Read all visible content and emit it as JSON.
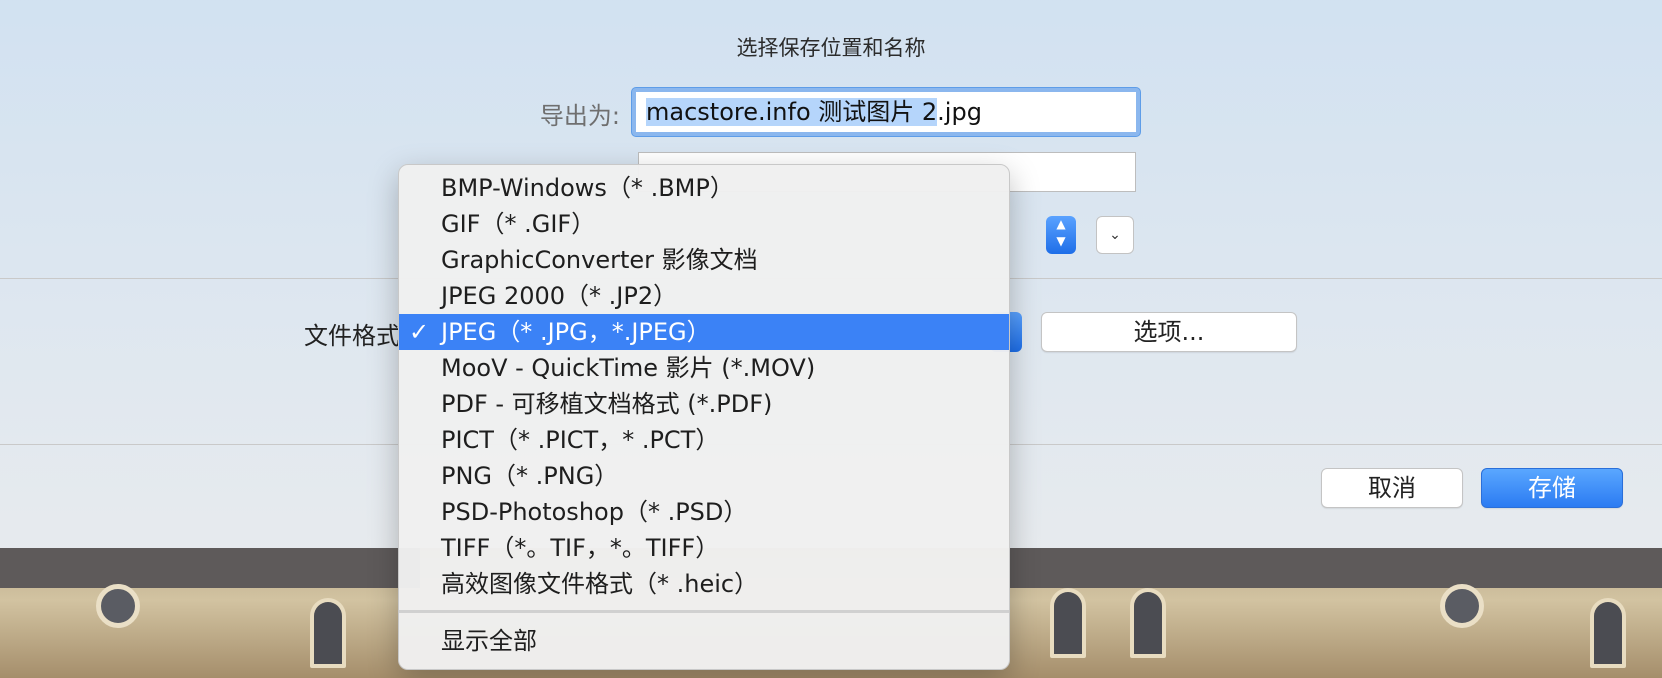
{
  "dialog": {
    "title": "选择保存位置和名称",
    "export_as_label": "导出为:",
    "filename_selected_part": "macstore.info 测试图片 2",
    "filename_extension": ".jpg",
    "format_label": "文件格式",
    "options_button": "选项...",
    "cancel_button": "取消",
    "save_button": "存储"
  },
  "format_menu": {
    "items": [
      "BMP-Windows（* .BMP）",
      "GIF（* .GIF）",
      "GraphicConverter 影像文档",
      "JPEG 2000（* .JP2）",
      "JPEG（* .JPG，*.JPEG）",
      "MooV - QuickTime 影片 (*.MOV)",
      "PDF - 可移植文档格式 (*.PDF)",
      "PICT（* .PICT，* .PCT）",
      "PNG（* .PNG）",
      "PSD-Photoshop（* .PSD）",
      "TIFF（*。TIF，*。TIFF）",
      "高效图像文件格式（* .heic）"
    ],
    "selected_index": 4,
    "show_all": "显示全部",
    "check_mark": "✓"
  },
  "icons": {
    "stepper": "up-down-chevron-icon",
    "disclosure": "chevron-down-icon"
  },
  "colors": {
    "accent": "#3b82f6",
    "selection_highlight": "#b5d5fb"
  }
}
